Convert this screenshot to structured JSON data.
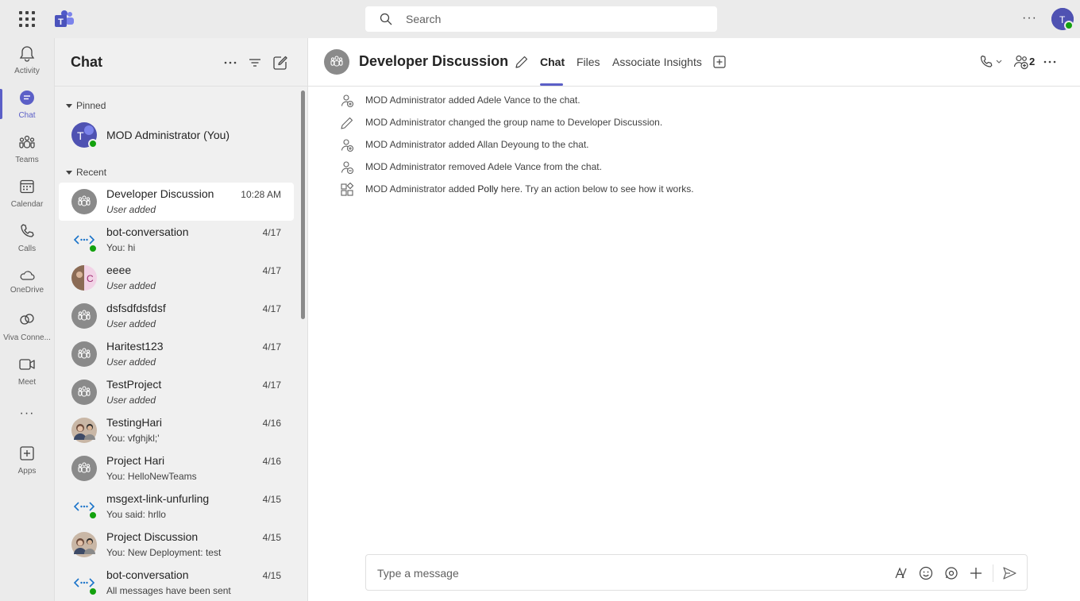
{
  "app": {
    "name": "Microsoft Teams"
  },
  "topbar": {
    "search_placeholder": "Search",
    "more_label": "···"
  },
  "rail": {
    "items": [
      {
        "label": "Activity",
        "icon": "bell-icon"
      },
      {
        "label": "Chat",
        "icon": "chat-icon",
        "active": true
      },
      {
        "label": "Teams",
        "icon": "teams-icon"
      },
      {
        "label": "Calendar",
        "icon": "calendar-icon"
      },
      {
        "label": "Calls",
        "icon": "phone-icon"
      },
      {
        "label": "OneDrive",
        "icon": "cloud-icon"
      },
      {
        "label": "Viva Conne...",
        "icon": "viva-connections-icon"
      },
      {
        "label": "Meet",
        "icon": "video-icon"
      },
      {
        "label": "···",
        "icon": "more-apps-icon"
      },
      {
        "label": "Apps",
        "icon": "add-app-icon"
      }
    ]
  },
  "chatlist": {
    "title": "Chat",
    "pinned_label": "Pinned",
    "recent_label": "Recent",
    "pinned": [
      {
        "name": "MOD Administrator (You)"
      }
    ],
    "recent": [
      {
        "name": "Developer Discussion",
        "preview": "User added",
        "time": "10:28 AM",
        "italic": true,
        "avatar": "group"
      },
      {
        "name": "bot-conversation",
        "preview": "You: hi",
        "time": "4/17",
        "italic": false,
        "avatar": "bot"
      },
      {
        "name": "eeee",
        "preview": "User added",
        "time": "4/17",
        "italic": true,
        "avatar": "split"
      },
      {
        "name": "dsfsdfdsfdsf",
        "preview": "User added",
        "time": "4/17",
        "italic": true,
        "avatar": "group"
      },
      {
        "name": "Haritest123",
        "preview": "User added",
        "time": "4/17",
        "italic": true,
        "avatar": "group"
      },
      {
        "name": "TestProject",
        "preview": "User added",
        "time": "4/17",
        "italic": true,
        "avatar": "group"
      },
      {
        "name": "TestingHari",
        "preview": "You: vfghjkl;'",
        "time": "4/16",
        "italic": false,
        "avatar": "photo"
      },
      {
        "name": "Project Hari",
        "preview": "You: HelloNewTeams",
        "time": "4/16",
        "italic": false,
        "avatar": "group"
      },
      {
        "name": "msgext-link-unfurling",
        "preview": "You said: hrllo",
        "time": "4/15",
        "italic": false,
        "avatar": "bot"
      },
      {
        "name": "Project Discussion",
        "preview": "You: New Deployment: test",
        "time": "4/15",
        "italic": false,
        "avatar": "photo"
      },
      {
        "name": "bot-conversation",
        "preview": "All messages have been sent",
        "time": "4/15",
        "italic": false,
        "avatar": "bot"
      }
    ]
  },
  "conversation": {
    "title": "Developer Discussion",
    "tabs": [
      {
        "label": "Chat",
        "active": true
      },
      {
        "label": "Files"
      },
      {
        "label": "Associate Insights"
      }
    ],
    "participant_count": "2",
    "events": [
      {
        "icon": "person-add-icon",
        "text": "MOD Administrator added Adele Vance to the chat."
      },
      {
        "icon": "pencil-icon",
        "text": "MOD Administrator changed the group name to Developer Discussion."
      },
      {
        "icon": "person-add-icon",
        "text": "MOD Administrator added Allan Deyoung to the chat."
      },
      {
        "icon": "person-remove-icon",
        "text": "MOD Administrator removed Adele Vance from the chat."
      },
      {
        "icon": "app-icon",
        "text_before": "MOD Administrator added ",
        "highlight": "Polly",
        "text_after": " here. Try an action below to see how it works."
      }
    ],
    "composer_placeholder": "Type a message"
  },
  "colors": {
    "accent": "#5b5fc7",
    "presence": "#13a10e"
  }
}
